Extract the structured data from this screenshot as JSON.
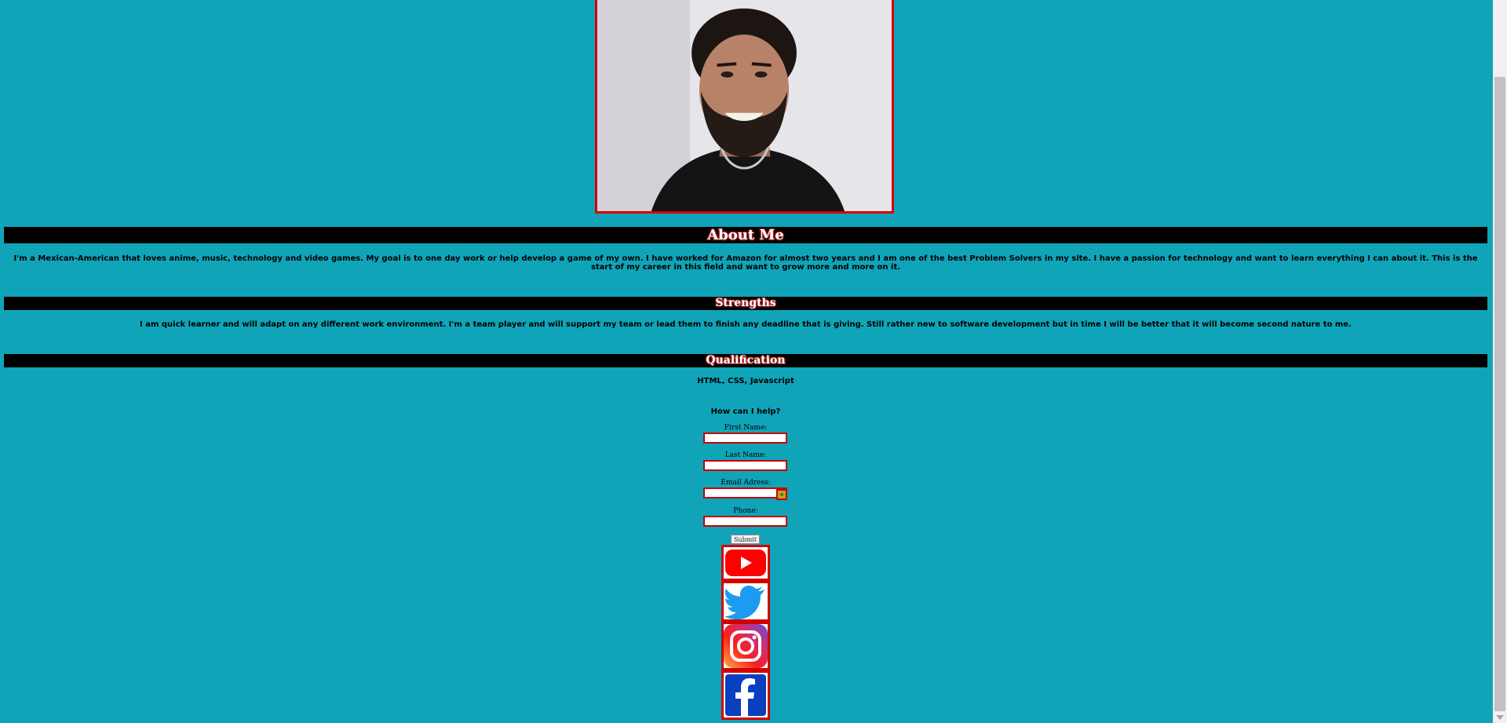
{
  "sections": {
    "about": {
      "heading": "About Me",
      "text": "I'm a Mexican-American that loves anime, music, technology and video games. My goal is to one day work or help develop a game of my own. I have worked for Amazon for almost two years and I am one of the best Problem Solvers in my site. I have a passion for technology and want to learn everything I can about it. This is the start of my career in this field and want to grow more and more on it."
    },
    "strengths": {
      "heading": "Strengths",
      "text": "I am quick learner and will adapt on any different work environment. I'm a team player and will support my team or lead them to finish any deadline that is giving. Still rather new to software development but in time I will be better that it will become second nature to me."
    },
    "qualification": {
      "heading": "Qualification",
      "text": "HTML, CSS, Javascript"
    }
  },
  "form": {
    "title": "How can I help?",
    "first_name_label": "First Name:",
    "first_name_value": "",
    "last_name_label": "Last Name:",
    "last_name_value": "",
    "email_label": "Email Adress:",
    "email_value": "",
    "phone_label": "Phone:",
    "phone_value": "",
    "submit_label": "Submit"
  },
  "social": [
    "youtube-icon",
    "twitter-icon",
    "instagram-icon",
    "facebook-icon"
  ],
  "colors": {
    "background": "#10a4b9",
    "bar": "#000000",
    "accent": "#d40000"
  }
}
